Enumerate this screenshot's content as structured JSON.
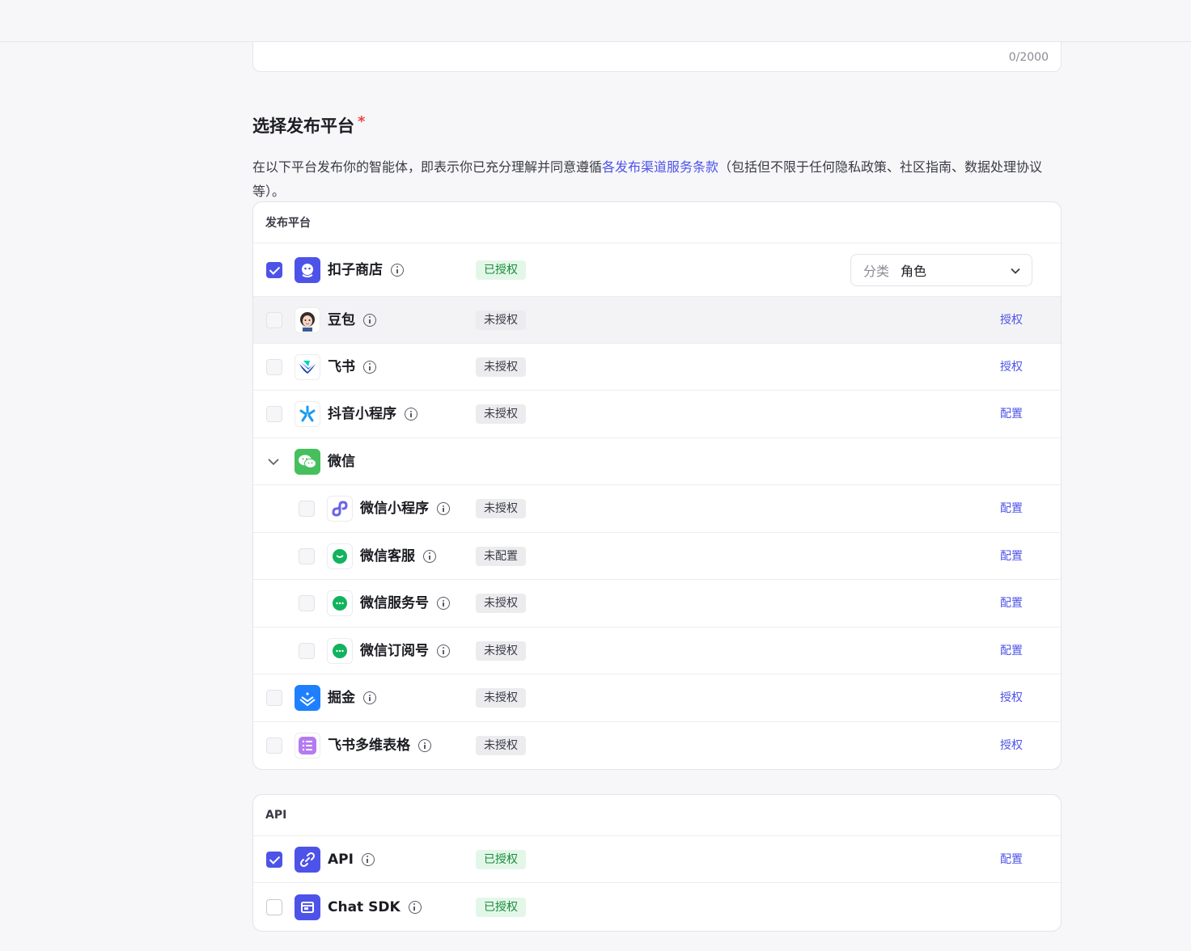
{
  "textarea": {
    "counter": "0/2000"
  },
  "section": {
    "title": "选择发布平台",
    "required_mark": "*",
    "desc_before": "在以下平台发布你的智能体，即表示你已充分理解并同意遵循",
    "desc_link": "各发布渠道服务条款",
    "desc_after": "（包括但不限于任何隐私政策、社区指南、数据处理协议等）。"
  },
  "platforms": {
    "header": "发布平台",
    "items": [
      {
        "name": "扣子商店",
        "status": "已授权",
        "checked": true,
        "category_label": "分类",
        "category_value": "角色",
        "icon": "coze-store-icon"
      },
      {
        "name": "豆包",
        "status": "未授权",
        "action": "授权",
        "checked": false,
        "icon": "doubao-avatar-icon"
      },
      {
        "name": "飞书",
        "status": "未授权",
        "action": "授权",
        "checked": false,
        "icon": "feishu-icon"
      },
      {
        "name": "抖音小程序",
        "status": "未授权",
        "action": "配置",
        "checked": false,
        "icon": "douyin-miniapp-icon"
      },
      {
        "name": "微信",
        "group": true,
        "icon": "wechat-icon"
      },
      {
        "name": "微信小程序",
        "status": "未授权",
        "action": "配置",
        "checked": false,
        "icon": "wechat-miniprogram-icon"
      },
      {
        "name": "微信客服",
        "status": "未配置",
        "action": "配置",
        "checked": false,
        "icon": "wechat-kefu-icon"
      },
      {
        "name": "微信服务号",
        "status": "未授权",
        "action": "配置",
        "checked": false,
        "icon": "wechat-service-icon"
      },
      {
        "name": "微信订阅号",
        "status": "未授权",
        "action": "配置",
        "checked": false,
        "icon": "wechat-subscription-icon"
      },
      {
        "name": "掘金",
        "status": "未授权",
        "action": "授权",
        "checked": false,
        "icon": "juejin-icon"
      },
      {
        "name": "飞书多维表格",
        "status": "未授权",
        "action": "授权",
        "checked": false,
        "icon": "feishu-bitable-icon"
      }
    ]
  },
  "api": {
    "header": "API",
    "items": [
      {
        "name": "API",
        "status": "已授权",
        "action": "配置",
        "checked": true,
        "icon": "api-icon"
      },
      {
        "name": "Chat SDK",
        "status": "已授权",
        "checked": false,
        "icon": "chat-sdk-icon"
      }
    ]
  },
  "colors": {
    "accent": "#4d53e8",
    "authorized_bg": "#e3f7e8",
    "authorized_text": "#1b8a3e",
    "required": "#ef4444"
  }
}
